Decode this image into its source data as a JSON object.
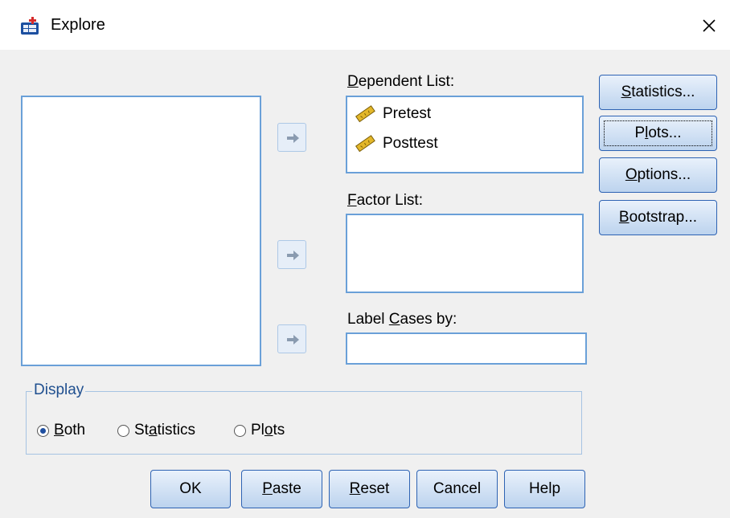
{
  "window": {
    "title": "Explore",
    "close_icon": "close-icon"
  },
  "source_list": {
    "items": []
  },
  "dependent_list": {
    "label_prefix": "",
    "label_mnemonic": "D",
    "label_rest": "ependent List:",
    "items": [
      {
        "name": "Pretest",
        "icon": "scale-variable-icon"
      },
      {
        "name": "Posttest",
        "icon": "scale-variable-icon"
      }
    ]
  },
  "factor_list": {
    "label_prefix": "",
    "label_mnemonic": "F",
    "label_rest": "actor List:",
    "items": []
  },
  "label_cases": {
    "label_prefix": "Label ",
    "label_mnemonic": "C",
    "label_rest": "ases by:",
    "value": ""
  },
  "side_buttons": [
    {
      "prefix": "",
      "mnemonic": "S",
      "rest": "tatistics..."
    },
    {
      "prefix": "P",
      "mnemonic": "l",
      "rest": "ots..."
    },
    {
      "prefix": "",
      "mnemonic": "O",
      "rest": "ptions..."
    },
    {
      "prefix": "",
      "mnemonic": "B",
      "rest": "ootstrap..."
    }
  ],
  "display": {
    "legend": "Display",
    "options": [
      {
        "prefix": "",
        "mnemonic": "B",
        "rest": "oth",
        "selected": true
      },
      {
        "prefix": "St",
        "mnemonic": "a",
        "rest": "tistics",
        "selected": false
      },
      {
        "prefix": "Pl",
        "mnemonic": "o",
        "rest": "ts",
        "selected": false
      }
    ]
  },
  "bottom_buttons": [
    {
      "prefix": "OK",
      "mnemonic": "",
      "rest": ""
    },
    {
      "prefix": "",
      "mnemonic": "P",
      "rest": "aste"
    },
    {
      "prefix": "",
      "mnemonic": "R",
      "rest": "eset"
    },
    {
      "prefix": "Cancel",
      "mnemonic": "",
      "rest": ""
    },
    {
      "prefix": "Help",
      "mnemonic": "",
      "rest": ""
    }
  ],
  "colors": {
    "accent": "#2e63b3",
    "listbox_border": "#6aa0d8",
    "dialog_bg": "#f0f0f0"
  }
}
